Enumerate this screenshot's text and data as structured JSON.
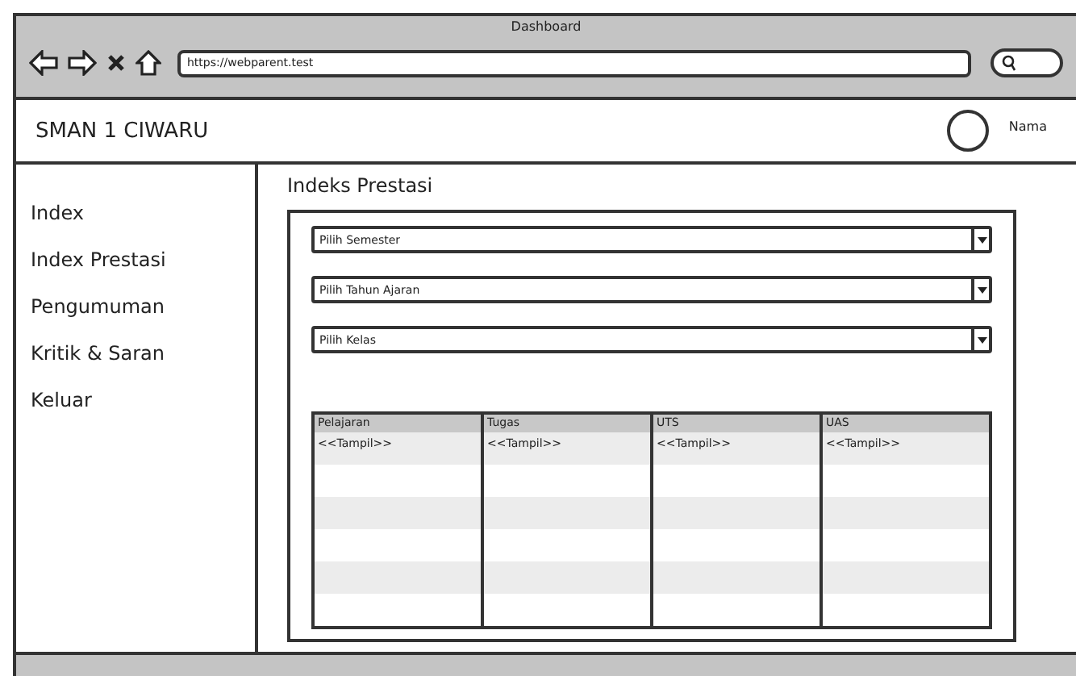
{
  "window": {
    "title": "Dashboard"
  },
  "browser": {
    "address": "https://webparent.test"
  },
  "header": {
    "brand": "SMAN 1 CIWARU",
    "user": "Nama"
  },
  "sidebar": {
    "items": [
      {
        "label": "Index"
      },
      {
        "label": "Index Prestasi"
      },
      {
        "label": "Pengumuman"
      },
      {
        "label": "Kritik & Saran"
      },
      {
        "label": "Keluar"
      }
    ]
  },
  "page_title": "Indeks Prestasi",
  "filters": [
    {
      "placeholder": "Pilih Semester"
    },
    {
      "placeholder": "Pilih Tahun Ajaran"
    },
    {
      "placeholder": "Pilih Kelas"
    }
  ],
  "table": {
    "columns": [
      "Pelajaran",
      "Tugas",
      "UTS",
      "UAS"
    ],
    "rows": [
      [
        "<<Tampil>>",
        "<<Tampil>>",
        "<<Tampil>>",
        "<<Tampil>>"
      ]
    ]
  }
}
